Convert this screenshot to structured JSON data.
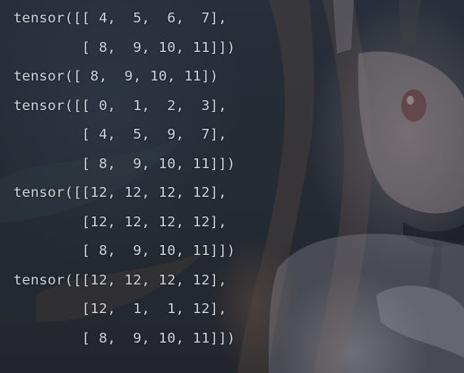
{
  "terminal": {
    "lines": [
      "tensor([[ 4,  5,  6,  7],",
      "        [ 8,  9, 10, 11]])",
      "tensor([ 8,  9, 10, 11])",
      "tensor([[ 0,  1,  2,  3],",
      "        [ 4,  5,  9,  7],",
      "        [ 8,  9, 10, 11]])",
      "tensor([[12, 12, 12, 12],",
      "        [12, 12, 12, 12],",
      "        [ 8,  9, 10, 11]])",
      "tensor([[12, 12, 12, 12],",
      "        [12,  1,  1, 12],",
      "        [ 8,  9, 10, 11]])"
    ]
  },
  "colors": {
    "text": "#d2d6de",
    "background": "#2a303a"
  }
}
